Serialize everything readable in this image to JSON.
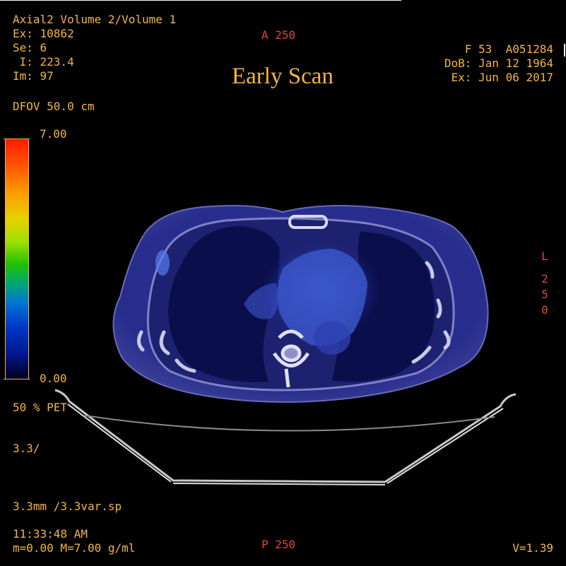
{
  "top_left": {
    "series_title": "Axial2 Volume 2/Volume 1",
    "exam": "Ex: 10862",
    "series": "Se: 6",
    "image_location": " I: 223.4",
    "image_number": "Im: 97",
    "dfov": "DFOV 50.0 cm"
  },
  "orientation": {
    "anterior": "A 250",
    "posterior": "P 250",
    "left": "L 250"
  },
  "title": "Early Scan",
  "patient": {
    "line1": "F 53  A051284",
    "dob": "DoB: Jan 12 1964",
    "exam_date": "Ex: Jun 06 2017"
  },
  "colorbar": {
    "max_label": "7.00",
    "min_label": "0.00",
    "max_value": 7.0,
    "min_value": 0.0
  },
  "bottom_left": {
    "blend": "50 % PET",
    "thickness": "3.3/",
    "spacing": "3.3mm /3.3var.sp",
    "time": "11:33:48 AM",
    "window": "m=0.00 M=7.00 g/ml"
  },
  "bottom_right": {
    "volume": "V=1.39"
  },
  "colors": {
    "overlay_text": "#f2b540",
    "orientation_text": "#e04a2c",
    "pet_blue": "#2a3cc8",
    "ct_gray": "#b8b8d8"
  }
}
